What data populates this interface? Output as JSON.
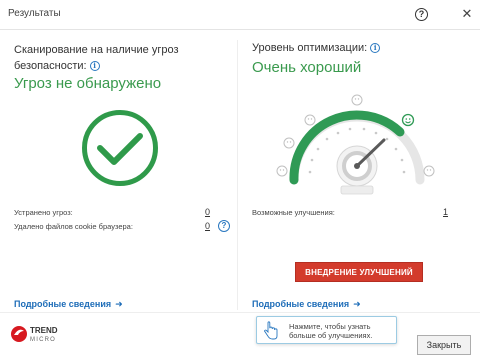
{
  "window": {
    "title": "Результаты",
    "help_label": "?",
    "close_label": "✕"
  },
  "scan": {
    "heading": "Сканирование на наличие угроз безопасности:",
    "status": "Угроз не обнаружено",
    "stats": [
      {
        "label": "Устранено угроз:",
        "value": "0"
      },
      {
        "label": "Удалено файлов cookie браузера:",
        "value": "0"
      }
    ],
    "details_link": "Подробные сведения"
  },
  "optimization": {
    "heading": "Уровень оптимизации:",
    "status": "Очень хороший",
    "improvements_label": "Возможные улучшения:",
    "improvements_value": "1",
    "apply_button": "ВНЕДРЕНИЕ УЛУЧШЕНИЙ",
    "details_link": "Подробные сведения",
    "tooltip": "Нажмите, чтобы узнать больше об улучшениях."
  },
  "footer": {
    "logo_lines": [
      "TREND",
      "MICRO"
    ],
    "close_button": "Закрыть"
  },
  "colors": {
    "accent_green": "#3a9a4e",
    "link_blue": "#1e6db8",
    "apply_red": "#d33b2c"
  },
  "icons": {
    "info": "info-icon",
    "help": "question-icon",
    "close": "close-icon",
    "checkmark": "checkmark-icon",
    "arrow": "arrow-right-icon",
    "hand": "hand-pointer-icon"
  }
}
